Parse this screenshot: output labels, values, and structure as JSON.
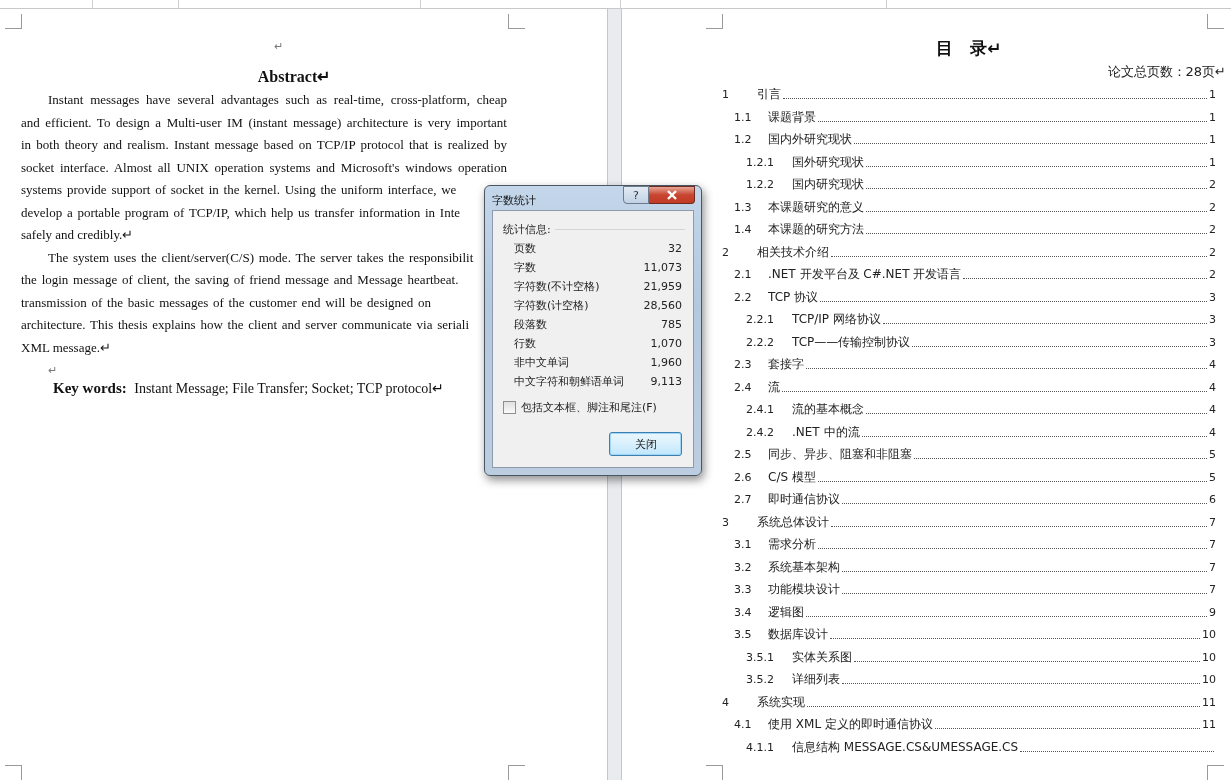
{
  "left_page": {
    "top_mark": "↵",
    "title": "Abstract↵",
    "paragraphs": [
      {
        "lines": [
          {
            "kind": "first",
            "text": "Instant messages have several advantages such as real-time, cross-platform, cheap"
          },
          {
            "kind": "full",
            "text": "and efficient. To design a Multi-user IM (instant message) architecture is very important"
          },
          {
            "kind": "full",
            "text": "in both theory and realism. Instant message based on TCP/IP protocol that is realized by"
          },
          {
            "kind": "full",
            "text": "socket interface. Almost all UNIX operation systems and Microsoft's windows operation"
          },
          {
            "kind": "cut",
            "text": "systems provide support of socket in the kernel. Using the uniform interface, we"
          },
          {
            "kind": "cut",
            "text": "develop a portable program of TCP/IP, which help us transfer information in Inte"
          },
          {
            "kind": "last",
            "text": "safely and credibly.↵"
          }
        ]
      },
      {
        "lines": [
          {
            "kind": "first_cut",
            "text": "The system uses the client/server(C/S) mode. The server takes the responsibilit"
          },
          {
            "kind": "cut",
            "text": "the login message of client, the saving of friend message and Message heartbeat."
          },
          {
            "kind": "cut",
            "text": "transmission of the basic messages of the customer end will be designed on"
          },
          {
            "kind": "cut",
            "text": "architecture. This thesis explains how the client and server communicate via seriali"
          },
          {
            "kind": "last",
            "text": "XML message.↵"
          }
        ]
      }
    ],
    "blank_mark": "↵",
    "keywords": "**Key words:**   Instant Message; File Transfer; Socket; TCP protocol↵"
  },
  "right_page": {
    "title": "目　录↵",
    "page_count": "论文总页数：28页↵",
    "toc": [
      {
        "number": "1",
        "title": "引言",
        "page": "1",
        "children": [
          {
            "number": "1.1",
            "title": "课题背景",
            "page": "1"
          },
          {
            "number": "1.2",
            "title": "国内外研究现状",
            "page": "1",
            "children": [
              {
                "number": "1.2.1",
                "title": "国外研究现状",
                "page": "1"
              },
              {
                "number": "1.2.2",
                "title": "国内研究现状",
                "page": "2"
              }
            ]
          },
          {
            "number": "1.3",
            "title": "本课题研究的意义",
            "page": "2"
          },
          {
            "number": "1.4",
            "title": "本课题的研究方法",
            "page": "2"
          }
        ]
      },
      {
        "number": "2",
        "title": "相关技术介绍",
        "page": "2",
        "children": [
          {
            "number": "2.1",
            "title": ".NET 开发平台及 C#.NET 开发语言",
            "page": "2"
          },
          {
            "number": "2.2",
            "title": "TCP 协议",
            "page": "3",
            "children": [
              {
                "number": "2.2.1",
                "title": "TCP/IP 网络协议",
                "page": "3"
              },
              {
                "number": "2.2.2",
                "title": "TCP——传输控制协议",
                "page": "3"
              }
            ]
          },
          {
            "number": "2.3",
            "title": "套接字",
            "page": "4"
          },
          {
            "number": "2.4",
            "title": "流",
            "page": "4",
            "children": [
              {
                "number": "2.4.1",
                "title": "流的基本概念",
                "page": "4"
              },
              {
                "number": "2.4.2",
                "title": ".NET 中的流",
                "page": "4"
              }
            ]
          },
          {
            "number": "2.5",
            "title": "同步、异步、阻塞和非阻塞",
            "page": "5"
          },
          {
            "number": "2.6",
            "title": "C/S 模型",
            "page": "5"
          },
          {
            "number": "2.7",
            "title": "即时通信协议",
            "page": "6"
          }
        ]
      },
      {
        "number": "3",
        "title": "系统总体设计",
        "page": "7",
        "children": [
          {
            "number": "3.1",
            "title": "需求分析",
            "page": "7"
          },
          {
            "number": "3.2",
            "title": "系统基本架构",
            "page": "7"
          },
          {
            "number": "3.3",
            "title": "功能模块设计",
            "page": "7"
          },
          {
            "number": "3.4",
            "title": "逻辑图",
            "page": "9"
          },
          {
            "number": "3.5",
            "title": "数据库设计",
            "page": "10",
            "children": [
              {
                "number": "3.5.1",
                "title": "实体关系图",
                "page": "10"
              },
              {
                "number": "3.5.2",
                "title": "详细列表",
                "page": "10"
              }
            ]
          }
        ]
      },
      {
        "number": "4",
        "title": "系统实现",
        "page": "11",
        "children": [
          {
            "number": "4.1",
            "title": "使用 XML 定义的即时通信协议",
            "page": "11",
            "children": [
              {
                "number": "4.1.1",
                "title": "信息结构 MESSAGE.CS&UMESSAGE.CS"
              }
            ]
          }
        ]
      }
    ]
  },
  "dialog": {
    "title": "字数统计",
    "help": "?",
    "group_label": "统计信息:",
    "stats": [
      {
        "label": "页数",
        "value": "32"
      },
      {
        "label": "字数",
        "value": "11,073"
      },
      {
        "label": "字符数(不计空格)",
        "value": "21,959"
      },
      {
        "label": "字符数(计空格)",
        "value": "28,560"
      },
      {
        "label": "段落数",
        "value": "785"
      },
      {
        "label": "行数",
        "value": "1,070"
      },
      {
        "label": "非中文单词",
        "value": "1,960"
      },
      {
        "label": "中文字符和朝鲜语单词",
        "value": "9,113"
      }
    ],
    "checkbox": {
      "label": "包括文本框、脚注和尾注(F)",
      "checked": false
    },
    "button": "关闭"
  }
}
